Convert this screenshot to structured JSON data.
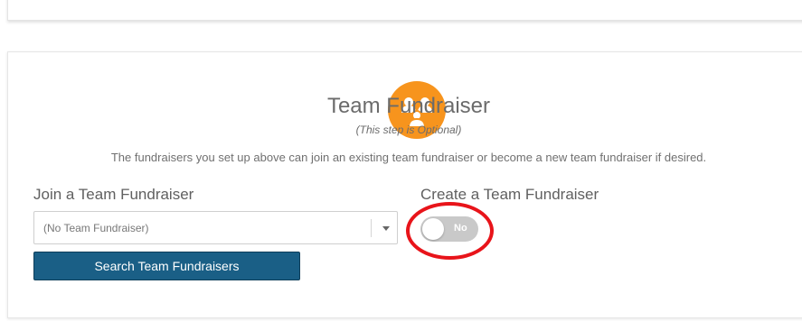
{
  "section": {
    "title": "Team Fundraiser",
    "subtitle": "(This step is Optional)",
    "description": "The fundraisers you set up above can join an existing team fundraiser or become a new team fundraiser if desired.",
    "icon": "team-people-icon",
    "icon_color": "#f7941d"
  },
  "join": {
    "label": "Join a Team Fundraiser",
    "select_value": "(No Team Fundraiser)",
    "search_button_label": "Search Team Fundraisers",
    "button_color": "#1a5f86"
  },
  "create": {
    "label": "Create a Team Fundraiser",
    "toggle_text": "No",
    "toggle_on": false
  },
  "annotation": {
    "highlight_color": "#e8141a"
  }
}
